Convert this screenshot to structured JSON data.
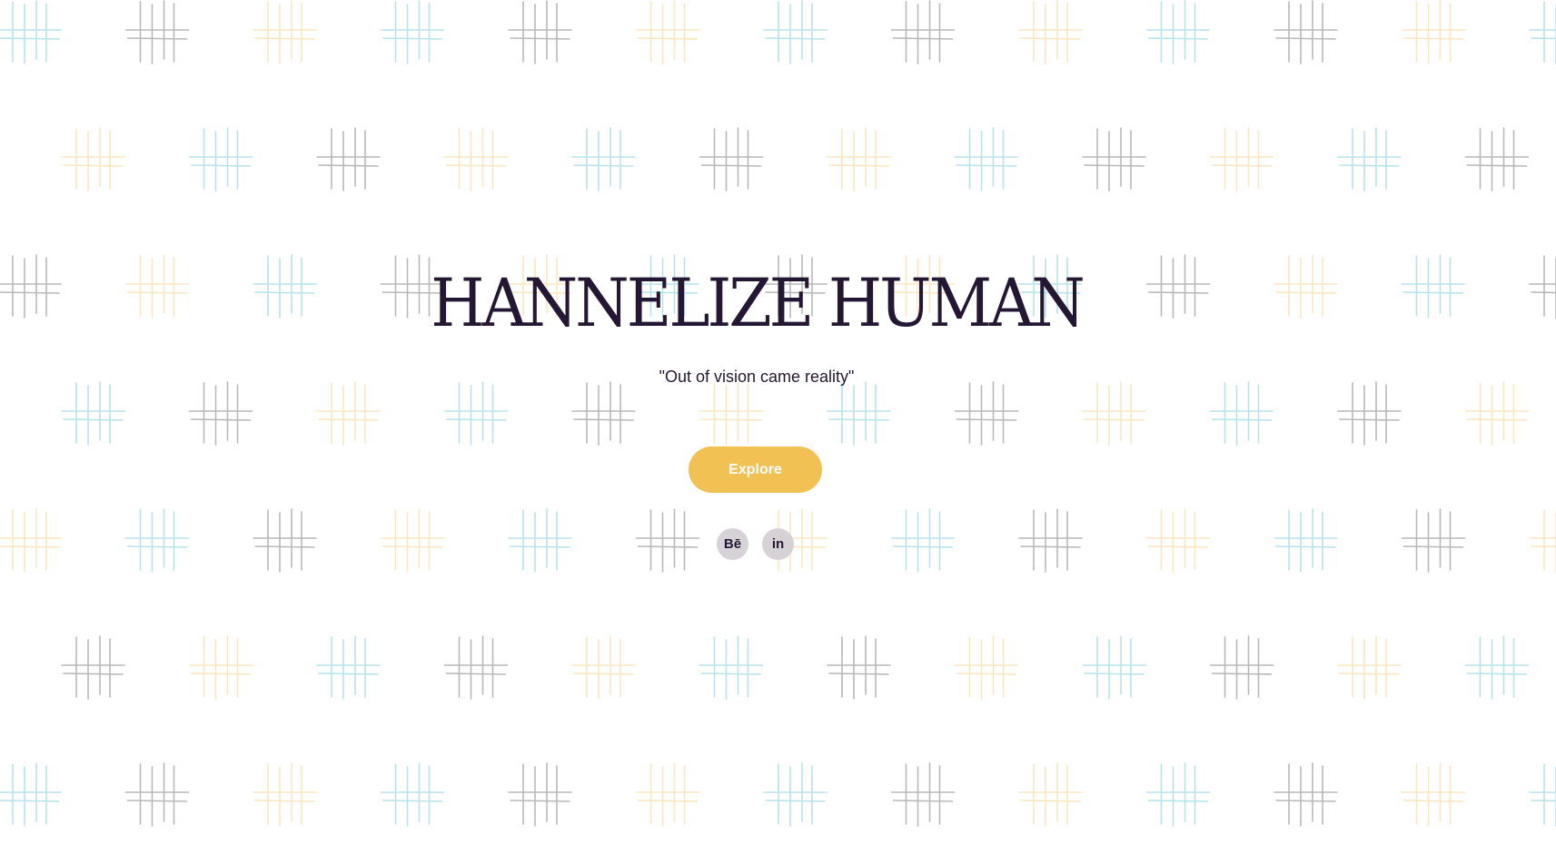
{
  "hero": {
    "title": "HANNELIZE HUMAN",
    "tagline": "\"Out of vision came reality\"",
    "explore_label": "Explore"
  },
  "social": {
    "behance_label": "Bē",
    "linkedin_label": "in"
  },
  "colors": {
    "background": "#ffffff",
    "title": "#241733",
    "accent_button": "#f2c154",
    "pattern_gray": "#b9b9b9",
    "pattern_blue": "#b7e3ec",
    "pattern_yellow": "#fbe6c0"
  },
  "icons": {
    "background_pattern": "hash-grid-icon"
  }
}
